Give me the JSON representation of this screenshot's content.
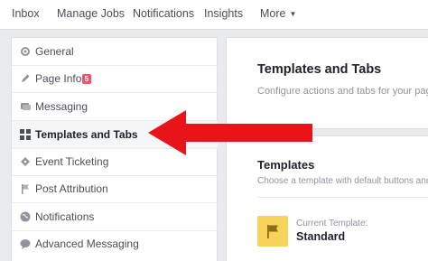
{
  "top_nav": {
    "items": [
      "Inbox",
      "Manage Jobs",
      "Notifications",
      "Insights",
      "More"
    ]
  },
  "sidebar": {
    "items": [
      {
        "label": "General",
        "icon": "gear-icon"
      },
      {
        "label": "Page Info",
        "icon": "pencil-icon",
        "badge": "5"
      },
      {
        "label": "Messaging",
        "icon": "chat-icon"
      },
      {
        "label": "Templates and Tabs",
        "icon": "grid-icon",
        "active": true
      },
      {
        "label": "Event Ticketing",
        "icon": "ticket-icon"
      },
      {
        "label": "Post Attribution",
        "icon": "flag-icon"
      },
      {
        "label": "Notifications",
        "icon": "globe-icon"
      },
      {
        "label": "Advanced Messaging",
        "icon": "chat-bubble-icon"
      }
    ]
  },
  "main": {
    "title": "Templates and Tabs",
    "subtitle": "Configure actions and tabs for your page",
    "templates_heading": "Templates",
    "templates_desc": "Choose a template with default buttons and tab",
    "current_template_label": "Current Template:",
    "current_template_value": "Standard"
  },
  "colors": {
    "arrow": "#e8141a",
    "badge": "#f25268",
    "template_icon": "#f7d35c"
  }
}
